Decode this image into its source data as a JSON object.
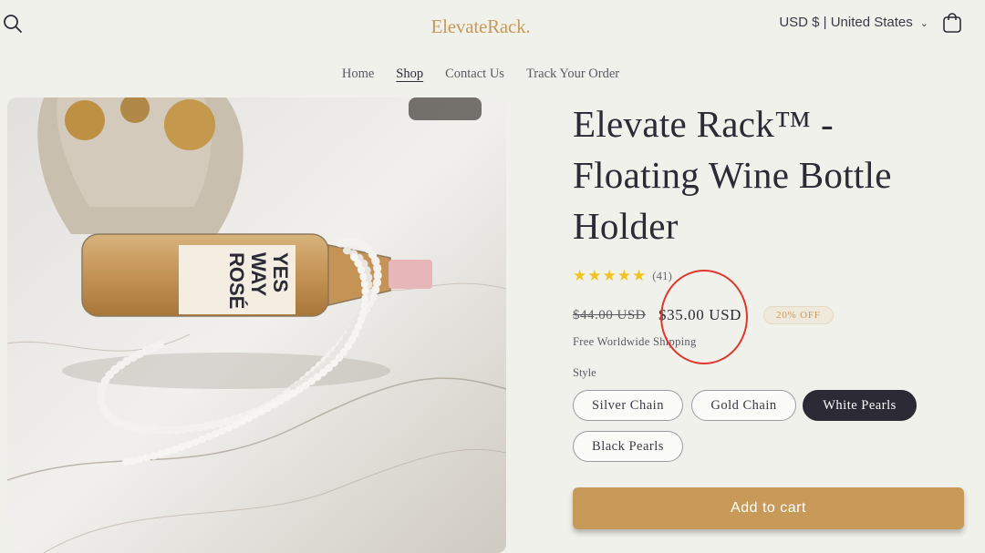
{
  "header": {
    "logo": "ElevateRack.",
    "currency": "USD $ | United States",
    "search_icon": "search-icon",
    "cart_icon": "shopping-bag-icon"
  },
  "nav": {
    "items": [
      {
        "label": "Home"
      },
      {
        "label": "Shop"
      },
      {
        "label": "Contact Us"
      },
      {
        "label": "Track Your Order"
      }
    ],
    "active": "Shop"
  },
  "product": {
    "image": {
      "bottle_label_line1": "YES",
      "bottle_label_line2": "WAY",
      "bottle_label_line3": "ROSÉ"
    },
    "title": "Elevate Rack™ - Floating Wine Bottle Holder",
    "rating": {
      "stars": 5,
      "count": "(41)"
    },
    "compare_price": "$44.00 USD",
    "price": "$35.00 USD",
    "discount_badge": "20% OFF",
    "shipping_note": "Free Worldwide Shipping",
    "style_label": "Style",
    "style_options": [
      {
        "label": "Silver Chain"
      },
      {
        "label": "Gold Chain"
      },
      {
        "label": "White Pearls"
      },
      {
        "label": "Black Pearls"
      }
    ],
    "selected_style": "White Pearls",
    "add_to_cart": "Add to cart"
  },
  "colors": {
    "accent": "#c79a5a",
    "dark": "#2b2a35",
    "annotation": "#e0362c",
    "star": "#f3c21c"
  }
}
